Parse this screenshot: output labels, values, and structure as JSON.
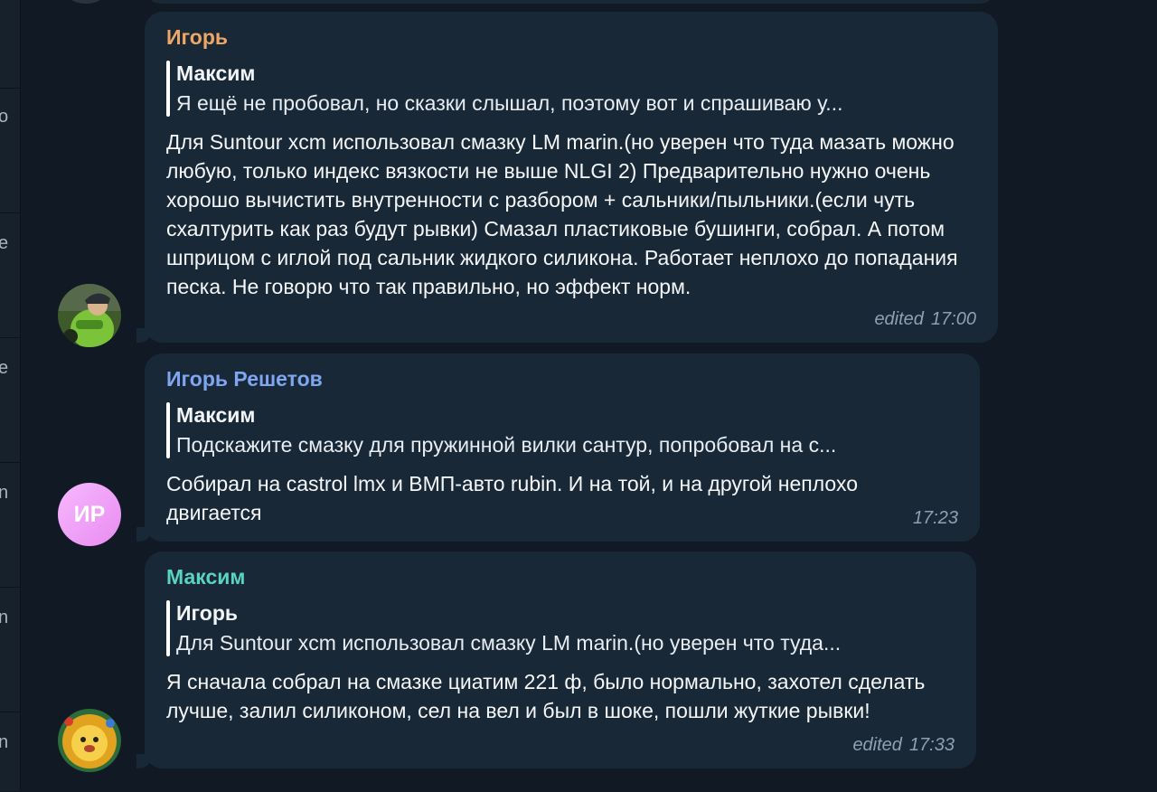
{
  "messages": [
    {
      "sender": "Игорь",
      "sender_color": "#f0a766",
      "reply_author": "Максим",
      "reply_text": "Я ещё не пробовал, но сказки слышал, поэтому вот и спрашиваю у...",
      "text": "Для Suntour xcm использовал смазку LM marin.(но уверен что туда мазать можно любую, только индекс вязкости не выше NLGI 2) Предварительно нужно очень хорошо вычистить внутренности с разбором + сальники/пыльники.(если чуть схалтурить как раз будут рывки) Смазал пластиковые бушинги, собрал. А потом шприцом с иглой под сальник жидкого силикона. Работает неплохо до попадания песка. Не говорю что так правильно, но эффект норм.",
      "edited": "edited",
      "time": "17:00",
      "avatar": "cyclist-photo-avatar"
    },
    {
      "sender": "Игорь Решетов",
      "sender_color": "#7fa6f0",
      "reply_author": "Максим",
      "reply_text": "Подскажите смазку для пружинной вилки сантур, попробовал на с...",
      "text": "Собирал на castrol lmx и ВМП-авто rubin. И на той, и на другой неплохо двигается",
      "edited": "",
      "time": "17:23",
      "avatar_initials": "ИР"
    },
    {
      "sender": "Максим",
      "sender_color": "#59d3c2",
      "reply_author": "Игорь",
      "reply_text": "Для Suntour xcm использовал смазку LM marin.(но уверен что туда...",
      "text": "Я сначала собрал на смазке циатим 221 ф, было нормально, захотел сделать лучше, залил силиконом, сел на вел и был в шоке, пошли жуткие рывки!",
      "edited": "edited",
      "time": "17:33",
      "avatar": "lion-cartoon-avatar"
    }
  ],
  "left_strip": [
    "o",
    "e",
    "e",
    "n",
    "n",
    "n"
  ]
}
